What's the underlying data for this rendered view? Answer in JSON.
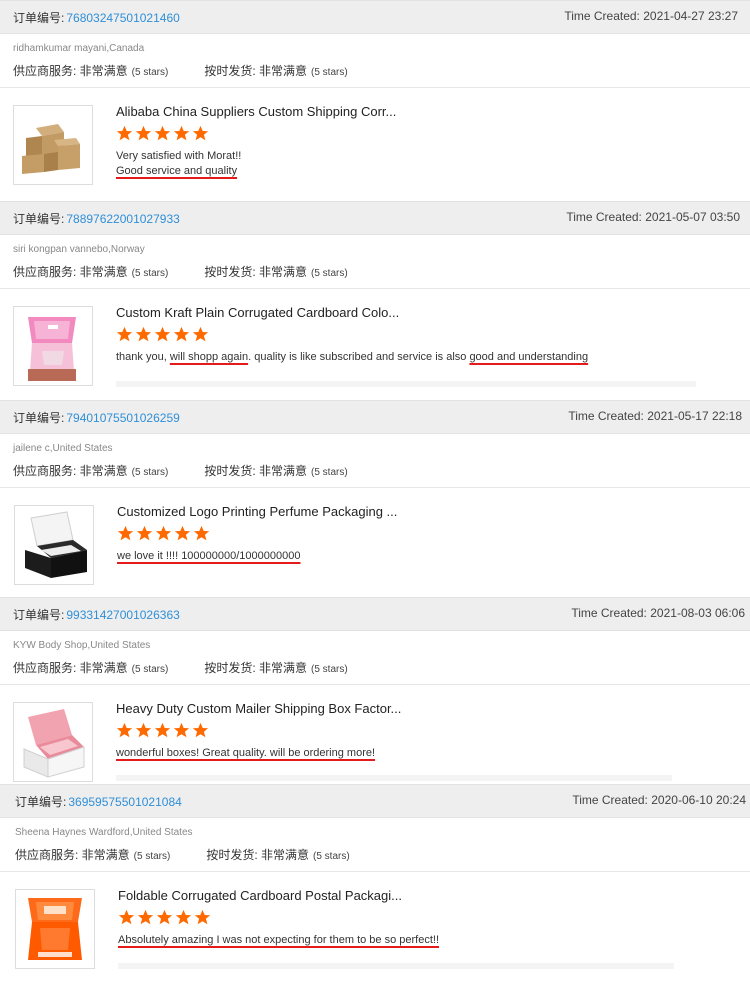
{
  "labels": {
    "order_no": "订单编号:",
    "time_created": "Time Created:",
    "supplier_service": "供应商服务: 非常满意",
    "on_time_shipping": "按时发货: 非常满意",
    "five_stars": "(5 stars)"
  },
  "colors": {
    "order_id": "#2f8fd8",
    "star": "#ff6a00",
    "underline": "#e51b1b",
    "header_bg": "#eeeeee"
  },
  "reviews": [
    {
      "order_id": "76803247501021460",
      "time": "2021-04-27 23:27",
      "buyer": "ridhamkumar mayani,Canada",
      "product_title": "Alibaba China Suppliers Custom Shipping Corr...",
      "rating": 5,
      "comment": "Very satisfied with Morat!!",
      "comment_line2": "Good service and quality",
      "thumb_icon": "kraft-boxes-image"
    },
    {
      "order_id": "78897622001027933",
      "time": "2021-05-07 03:50",
      "buyer": "siri kongpan vannebo,Norway",
      "product_title": "Custom Kraft Plain Corrugated Cardboard Colo...",
      "rating": 5,
      "comment_a": "thank you, ",
      "comment_b": "will shopp again",
      "comment_c": ". quality is like subscribed and service is also ",
      "comment_d": "good and understanding",
      "thumb_icon": "pink-mailer-box-image"
    },
    {
      "order_id": "79401075501026259",
      "time": "2021-05-17 22:18",
      "buyer": "jailene c,United States",
      "product_title": "Customized Logo Printing Perfume Packaging ...",
      "rating": 5,
      "comment": "we love it !!!! 100000000/1000000000",
      "thumb_icon": "black-mailer-box-image"
    },
    {
      "order_id": "99331427001026363",
      "time": "2021-08-03 06:06",
      "buyer": "KYW Body Shop,United States",
      "product_title": "Heavy Duty Custom Mailer Shipping Box Factor...",
      "rating": 5,
      "comment": "wonderful boxes! Great quality. will be ordering more!",
      "thumb_icon": "pink-white-mailer-box-image"
    },
    {
      "order_id": "36959575501021084",
      "time": "2020-06-10 20:24",
      "buyer": "Sheena Haynes Wardford,United States",
      "product_title": "Foldable Corrugated Cardboard Postal Packagi...",
      "rating": 5,
      "comment": "Absolutely amazing I was not expecting for them to be so perfect!!",
      "thumb_icon": "orange-mailer-box-image"
    }
  ]
}
